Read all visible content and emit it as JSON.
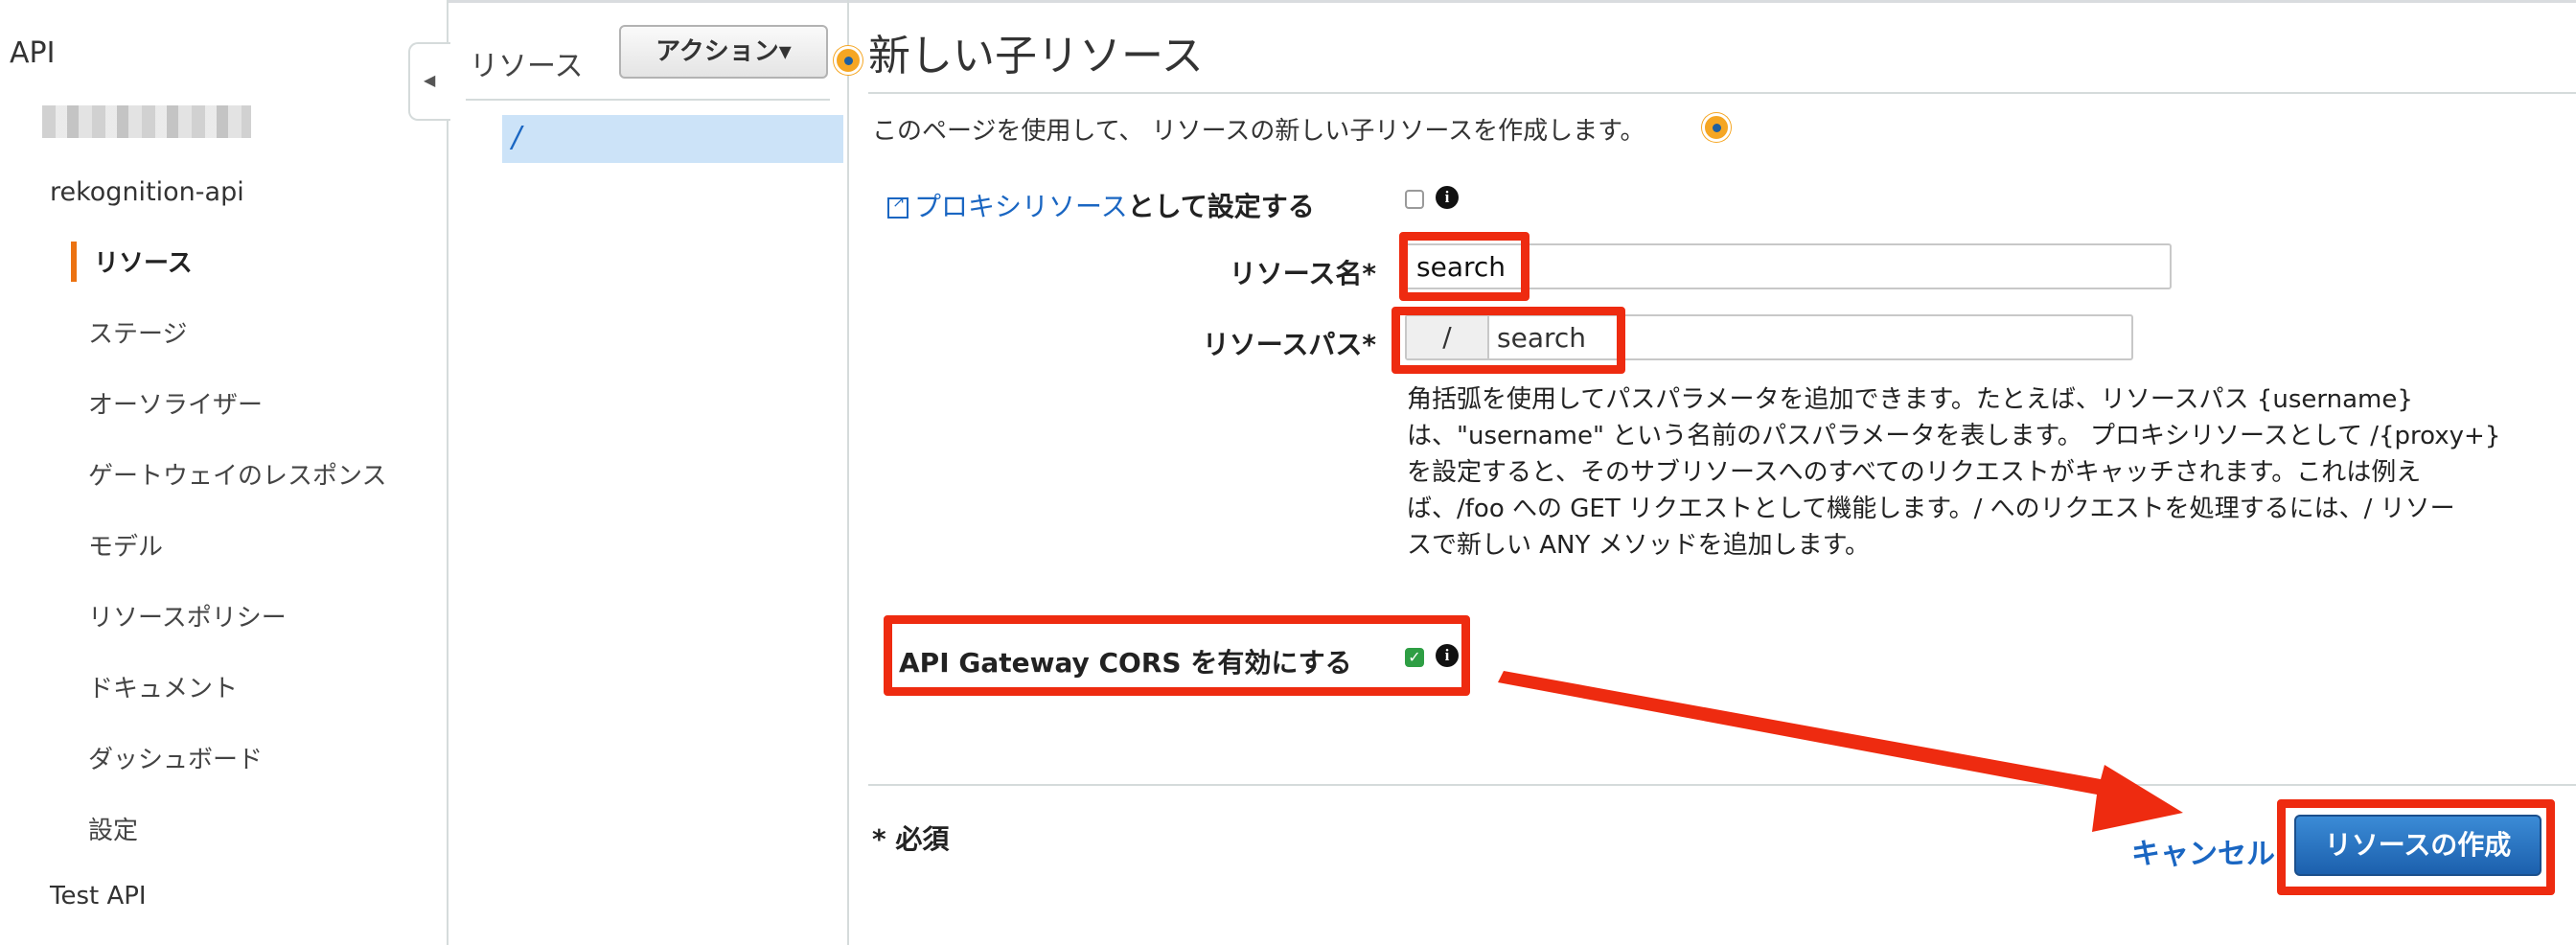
{
  "sidebar": {
    "section_title": "API",
    "api_name": "rekognition-api",
    "items": [
      {
        "label": "リソース"
      },
      {
        "label": "ステージ"
      },
      {
        "label": "オーソライザー"
      },
      {
        "label": "ゲートウェイのレスポンス"
      },
      {
        "label": "モデル"
      },
      {
        "label": "リソースポリシー"
      },
      {
        "label": "ドキュメント"
      },
      {
        "label": "ダッシュボード"
      },
      {
        "label": "設定"
      }
    ],
    "next_api": "Test API"
  },
  "tree": {
    "title": "リソース",
    "actions_label": "アクション▾",
    "root_path": "/"
  },
  "main": {
    "title": "新しい子リソース",
    "description": "このページを使用して、 リソースの新しい子リソースを作成します。",
    "proxy_link": "プロキシリソース",
    "proxy_suffix": "として設定する",
    "resource_name_label": "リソース名*",
    "resource_name_value": "search",
    "resource_path_label": "リソースパス*",
    "resource_path_prefix": "/",
    "resource_path_value": "search",
    "help_lines": [
      "角括弧を使用してパスパラメータを追加できます。たとえば、リソースパス {username}",
      "は、\"username\" という名前のパスパラメータを表します。 プロキシリソースとして /{proxy+}",
      "を設定すると、そのサブリソースへのすべてのリクエストがキャッチされます。これは例え",
      "ば、/foo への GET リクエストとして機能します。/ へのリクエストを処理するには、/ リソー",
      "スで新しい ANY メソッドを追加します。"
    ],
    "cors_label": "API Gateway CORS を有効にする",
    "cors_checked": true,
    "proxy_checked": false,
    "required_note": "* 必須",
    "cancel_label": "キャンセル",
    "create_label": "リソースの作成"
  },
  "colors": {
    "annotation_red": "#ee2b10",
    "link_blue": "#1a66c2",
    "primary_button": "#1c60ad",
    "active_indicator": "#ec7211"
  }
}
